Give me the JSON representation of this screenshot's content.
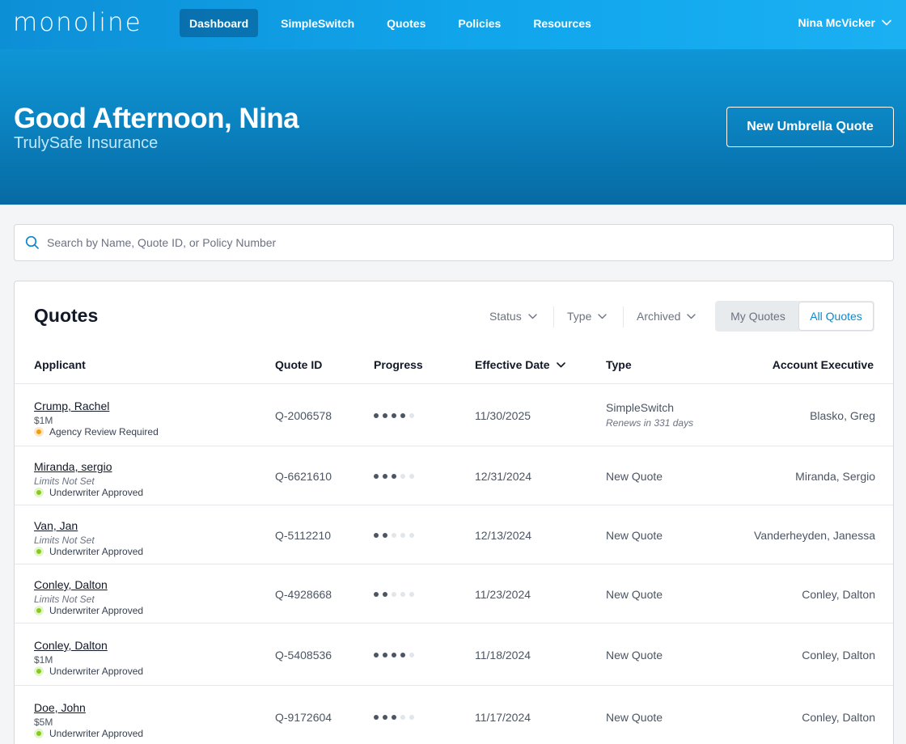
{
  "nav": {
    "logo": "monoline",
    "items": [
      {
        "label": "Dashboard",
        "active": true
      },
      {
        "label": "SimpleSwitch",
        "active": false
      },
      {
        "label": "Quotes",
        "active": false
      },
      {
        "label": "Policies",
        "active": false
      },
      {
        "label": "Resources",
        "active": false
      }
    ],
    "user_name": "Nina McVicker"
  },
  "hero": {
    "greeting": "Good Afternoon, Nina",
    "company": "TrulySafe Insurance",
    "cta_label": "New Umbrella Quote"
  },
  "search": {
    "placeholder": "Search by Name, Quote ID, or Policy Number",
    "value": ""
  },
  "quotes": {
    "title": "Quotes",
    "filters": [
      "Status",
      "Type",
      "Archived"
    ],
    "scope": {
      "options": [
        "My Quotes",
        "All Quotes"
      ],
      "selected": "All Quotes"
    },
    "columns": [
      "Applicant",
      "Quote ID",
      "Progress",
      "Effective Date",
      "Type",
      "Account Executive"
    ],
    "sort": {
      "column": "Effective Date",
      "direction": "descending"
    },
    "rows": [
      {
        "name": "Crump, Rachel",
        "limit": "$1M",
        "limit_set": true,
        "status": "Agency Review Required",
        "status_kind": "warning",
        "quote_id": "Q-2006578",
        "progress": 4,
        "progress_max": 5,
        "effective_date": "11/30/2025",
        "type": "SimpleSwitch",
        "type_note": "Renews in 331 days",
        "ae": "Blasko, Greg"
      },
      {
        "name": "Miranda, sergio",
        "limit": "Limits Not Set",
        "limit_set": false,
        "status": "Underwriter Approved",
        "status_kind": "success",
        "quote_id": "Q-6621610",
        "progress": 3,
        "progress_max": 5,
        "effective_date": "12/31/2024",
        "type": "New Quote",
        "type_note": "",
        "ae": "Miranda, Sergio"
      },
      {
        "name": "Van, Jan",
        "limit": "Limits Not Set",
        "limit_set": false,
        "status": "Underwriter Approved",
        "status_kind": "success",
        "quote_id": "Q-5112210",
        "progress": 2,
        "progress_max": 5,
        "effective_date": "12/13/2024",
        "type": "New Quote",
        "type_note": "",
        "ae": "Vanderheyden, Janessa"
      },
      {
        "name": "Conley, Dalton",
        "limit": "Limits Not Set",
        "limit_set": false,
        "status": "Underwriter Approved",
        "status_kind": "success",
        "quote_id": "Q-4928668",
        "progress": 2,
        "progress_max": 5,
        "effective_date": "11/23/2024",
        "type": "New Quote",
        "type_note": "",
        "ae": "Conley, Dalton"
      },
      {
        "name": "Conley, Dalton",
        "limit": "$1M",
        "limit_set": true,
        "status": "Underwriter Approved",
        "status_kind": "success",
        "quote_id": "Q-5408536",
        "progress": 4,
        "progress_max": 5,
        "effective_date": "11/18/2024",
        "type": "New Quote",
        "type_note": "",
        "ae": "Conley, Dalton"
      },
      {
        "name": "Doe, John",
        "limit": "$5M",
        "limit_set": true,
        "status": "Underwriter Approved",
        "status_kind": "success",
        "quote_id": "Q-9172604",
        "progress": 3,
        "progress_max": 5,
        "effective_date": "11/17/2024",
        "type": "New Quote",
        "type_note": "",
        "ae": "Conley, Dalton"
      }
    ]
  },
  "colors": {
    "nav_gradient_start": "#0d8fd6",
    "hero_bottom": "#076aa3",
    "accent": "#0a8ad0",
    "status_warning": "#f59e0b",
    "status_success": "#84cc16"
  },
  "icons": {
    "search": "search-icon",
    "user_menu": "chevron-down-icon",
    "filter": "chevron-down-icon",
    "sort": "chevron-down-icon"
  }
}
